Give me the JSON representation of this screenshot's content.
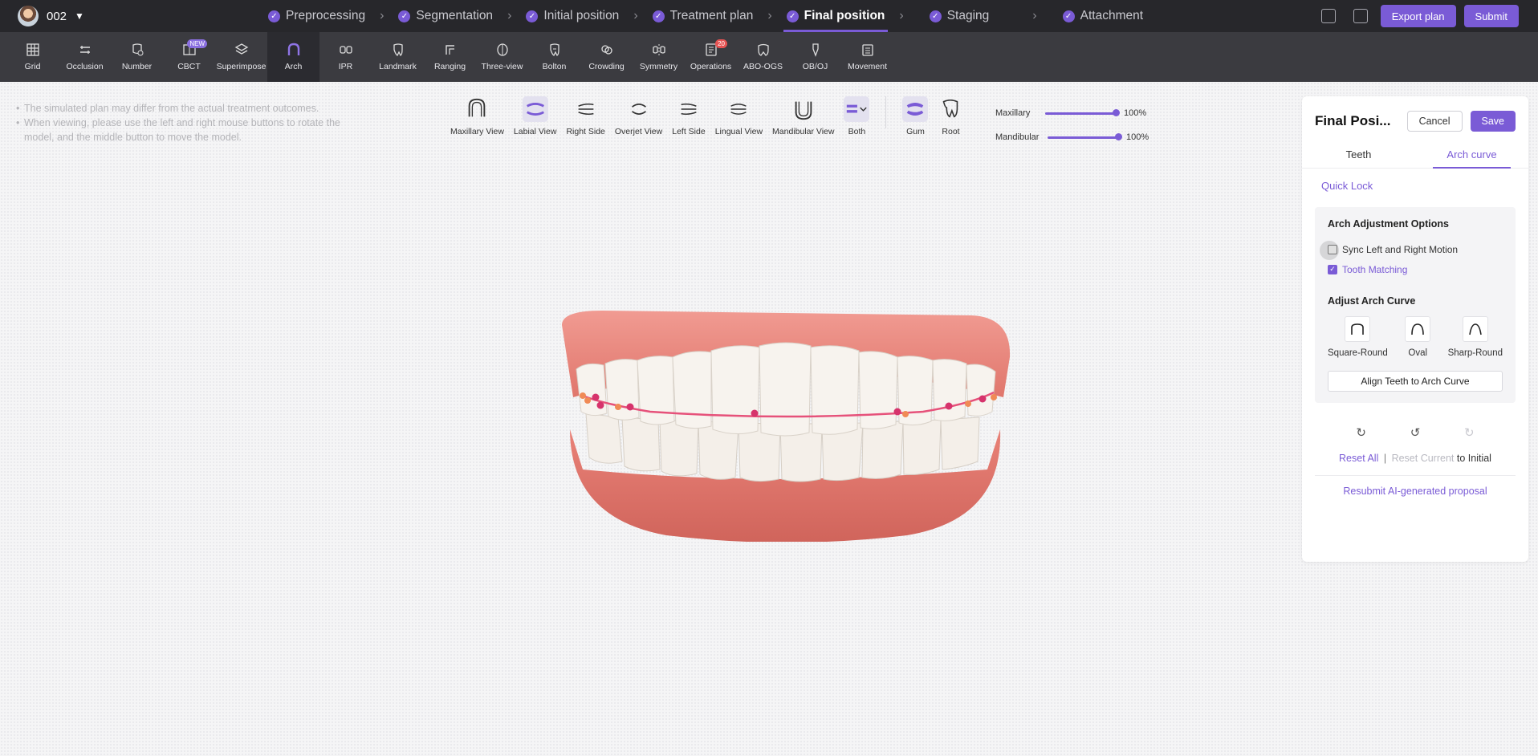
{
  "patient": {
    "id": "002"
  },
  "steps": [
    {
      "label": "Preprocessing",
      "active": false
    },
    {
      "label": "Segmentation",
      "active": false
    },
    {
      "label": "Initial position",
      "active": false
    },
    {
      "label": "Treatment plan",
      "active": false
    },
    {
      "label": "Final position",
      "active": true
    },
    {
      "label": "Staging",
      "active": false
    },
    {
      "label": "Attachment",
      "active": false
    }
  ],
  "topbar": {
    "export_label": "Export plan",
    "submit_label": "Submit"
  },
  "tools": [
    {
      "label": "Grid",
      "icon": "grid-icon"
    },
    {
      "label": "Occlusion",
      "icon": "occlusion-icon"
    },
    {
      "label": "Number",
      "icon": "number-icon"
    },
    {
      "label": "CBCT",
      "icon": "cbct-icon",
      "badge": "NEW"
    },
    {
      "label": "Superimpose",
      "icon": "superimpose-icon"
    },
    {
      "label": "Arch",
      "icon": "arch-icon",
      "active": true
    },
    {
      "label": "IPR",
      "icon": "ipr-icon"
    },
    {
      "label": "Landmark",
      "icon": "landmark-icon"
    },
    {
      "label": "Ranging",
      "icon": "ranging-icon"
    },
    {
      "label": "Three-view",
      "icon": "three-view-icon"
    },
    {
      "label": "Bolton",
      "icon": "bolton-icon"
    },
    {
      "label": "Crowding",
      "icon": "crowding-icon"
    },
    {
      "label": "Symmetry",
      "icon": "symmetry-icon"
    },
    {
      "label": "Operations",
      "icon": "operations-icon",
      "badge": "20"
    },
    {
      "label": "ABO-OGS",
      "icon": "abo-ogs-icon"
    },
    {
      "label": "OB/OJ",
      "icon": "ob-oj-icon"
    },
    {
      "label": "Movement",
      "icon": "movement-icon"
    }
  ],
  "notes": [
    "The simulated plan may differ from the actual treatment outcomes.",
    "When viewing, please use the left and right mouse buttons to rotate the model, and the middle button to move the model."
  ],
  "views": [
    {
      "label": "Maxillary View",
      "icon": "maxillary-view-icon"
    },
    {
      "label": "Labial View",
      "icon": "labial-view-icon",
      "active": true
    },
    {
      "label": "Right Side",
      "icon": "right-side-icon"
    },
    {
      "label": "Overjet View",
      "icon": "overjet-view-icon"
    },
    {
      "label": "Left Side",
      "icon": "left-side-icon"
    },
    {
      "label": "Lingual View",
      "icon": "lingual-view-icon"
    },
    {
      "label": "Mandibular View",
      "icon": "mandibular-view-icon"
    },
    {
      "label": "Both",
      "icon": "both-icon",
      "active": true
    }
  ],
  "display": [
    {
      "label": "Gum",
      "icon": "gum-icon",
      "active": true
    },
    {
      "label": "Root",
      "icon": "root-icon"
    }
  ],
  "opacity": [
    {
      "label": "Maxillary",
      "value": "100%",
      "fraction": 1.0
    },
    {
      "label": "Mandibular",
      "value": "100%",
      "fraction": 1.0
    }
  ],
  "panel": {
    "title": "Final Posi...",
    "cancel_label": "Cancel",
    "save_label": "Save",
    "tabs": [
      {
        "label": "Teeth",
        "active": false
      },
      {
        "label": "Arch curve",
        "active": true
      }
    ],
    "quick_lock": "Quick Lock",
    "options_title": "Arch Adjustment Options",
    "sync_label": "Sync Left and Right Motion",
    "sync_checked": false,
    "matching_label": "Tooth Matching",
    "matching_checked": true,
    "curve_title": "Adjust Arch Curve",
    "curves": [
      "Square-Round",
      "Oval",
      "Sharp-Round"
    ],
    "align_label": "Align Teeth to Arch Curve",
    "reset_all": "Reset All",
    "reset_sep": "|",
    "reset_current": "Reset Current",
    "reset_suffix": "to Initial",
    "resubmit": "Resubmit AI-generated proposal"
  },
  "colors": {
    "accent": "#7a5bd6",
    "topbar": "#27272b",
    "toolbar": "#3b3b40"
  }
}
